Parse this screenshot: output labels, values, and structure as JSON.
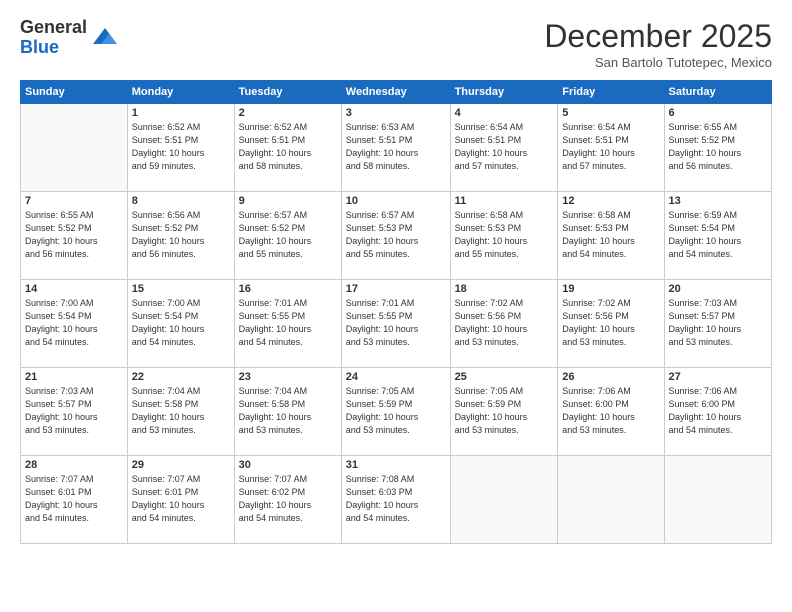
{
  "logo": {
    "general": "General",
    "blue": "Blue"
  },
  "header": {
    "month_title": "December 2025",
    "subtitle": "San Bartolo Tutotepec, Mexico"
  },
  "weekdays": [
    "Sunday",
    "Monday",
    "Tuesday",
    "Wednesday",
    "Thursday",
    "Friday",
    "Saturday"
  ],
  "weeks": [
    [
      {
        "day": "",
        "info": ""
      },
      {
        "day": "1",
        "info": "Sunrise: 6:52 AM\nSunset: 5:51 PM\nDaylight: 10 hours\nand 59 minutes."
      },
      {
        "day": "2",
        "info": "Sunrise: 6:52 AM\nSunset: 5:51 PM\nDaylight: 10 hours\nand 58 minutes."
      },
      {
        "day": "3",
        "info": "Sunrise: 6:53 AM\nSunset: 5:51 PM\nDaylight: 10 hours\nand 58 minutes."
      },
      {
        "day": "4",
        "info": "Sunrise: 6:54 AM\nSunset: 5:51 PM\nDaylight: 10 hours\nand 57 minutes."
      },
      {
        "day": "5",
        "info": "Sunrise: 6:54 AM\nSunset: 5:51 PM\nDaylight: 10 hours\nand 57 minutes."
      },
      {
        "day": "6",
        "info": "Sunrise: 6:55 AM\nSunset: 5:52 PM\nDaylight: 10 hours\nand 56 minutes."
      }
    ],
    [
      {
        "day": "7",
        "info": "Sunrise: 6:55 AM\nSunset: 5:52 PM\nDaylight: 10 hours\nand 56 minutes."
      },
      {
        "day": "8",
        "info": "Sunrise: 6:56 AM\nSunset: 5:52 PM\nDaylight: 10 hours\nand 56 minutes."
      },
      {
        "day": "9",
        "info": "Sunrise: 6:57 AM\nSunset: 5:52 PM\nDaylight: 10 hours\nand 55 minutes."
      },
      {
        "day": "10",
        "info": "Sunrise: 6:57 AM\nSunset: 5:53 PM\nDaylight: 10 hours\nand 55 minutes."
      },
      {
        "day": "11",
        "info": "Sunrise: 6:58 AM\nSunset: 5:53 PM\nDaylight: 10 hours\nand 55 minutes."
      },
      {
        "day": "12",
        "info": "Sunrise: 6:58 AM\nSunset: 5:53 PM\nDaylight: 10 hours\nand 54 minutes."
      },
      {
        "day": "13",
        "info": "Sunrise: 6:59 AM\nSunset: 5:54 PM\nDaylight: 10 hours\nand 54 minutes."
      }
    ],
    [
      {
        "day": "14",
        "info": "Sunrise: 7:00 AM\nSunset: 5:54 PM\nDaylight: 10 hours\nand 54 minutes."
      },
      {
        "day": "15",
        "info": "Sunrise: 7:00 AM\nSunset: 5:54 PM\nDaylight: 10 hours\nand 54 minutes."
      },
      {
        "day": "16",
        "info": "Sunrise: 7:01 AM\nSunset: 5:55 PM\nDaylight: 10 hours\nand 54 minutes."
      },
      {
        "day": "17",
        "info": "Sunrise: 7:01 AM\nSunset: 5:55 PM\nDaylight: 10 hours\nand 53 minutes."
      },
      {
        "day": "18",
        "info": "Sunrise: 7:02 AM\nSunset: 5:56 PM\nDaylight: 10 hours\nand 53 minutes."
      },
      {
        "day": "19",
        "info": "Sunrise: 7:02 AM\nSunset: 5:56 PM\nDaylight: 10 hours\nand 53 minutes."
      },
      {
        "day": "20",
        "info": "Sunrise: 7:03 AM\nSunset: 5:57 PM\nDaylight: 10 hours\nand 53 minutes."
      }
    ],
    [
      {
        "day": "21",
        "info": "Sunrise: 7:03 AM\nSunset: 5:57 PM\nDaylight: 10 hours\nand 53 minutes."
      },
      {
        "day": "22",
        "info": "Sunrise: 7:04 AM\nSunset: 5:58 PM\nDaylight: 10 hours\nand 53 minutes."
      },
      {
        "day": "23",
        "info": "Sunrise: 7:04 AM\nSunset: 5:58 PM\nDaylight: 10 hours\nand 53 minutes."
      },
      {
        "day": "24",
        "info": "Sunrise: 7:05 AM\nSunset: 5:59 PM\nDaylight: 10 hours\nand 53 minutes."
      },
      {
        "day": "25",
        "info": "Sunrise: 7:05 AM\nSunset: 5:59 PM\nDaylight: 10 hours\nand 53 minutes."
      },
      {
        "day": "26",
        "info": "Sunrise: 7:06 AM\nSunset: 6:00 PM\nDaylight: 10 hours\nand 53 minutes."
      },
      {
        "day": "27",
        "info": "Sunrise: 7:06 AM\nSunset: 6:00 PM\nDaylight: 10 hours\nand 54 minutes."
      }
    ],
    [
      {
        "day": "28",
        "info": "Sunrise: 7:07 AM\nSunset: 6:01 PM\nDaylight: 10 hours\nand 54 minutes."
      },
      {
        "day": "29",
        "info": "Sunrise: 7:07 AM\nSunset: 6:01 PM\nDaylight: 10 hours\nand 54 minutes."
      },
      {
        "day": "30",
        "info": "Sunrise: 7:07 AM\nSunset: 6:02 PM\nDaylight: 10 hours\nand 54 minutes."
      },
      {
        "day": "31",
        "info": "Sunrise: 7:08 AM\nSunset: 6:03 PM\nDaylight: 10 hours\nand 54 minutes."
      },
      {
        "day": "",
        "info": ""
      },
      {
        "day": "",
        "info": ""
      },
      {
        "day": "",
        "info": ""
      }
    ]
  ]
}
